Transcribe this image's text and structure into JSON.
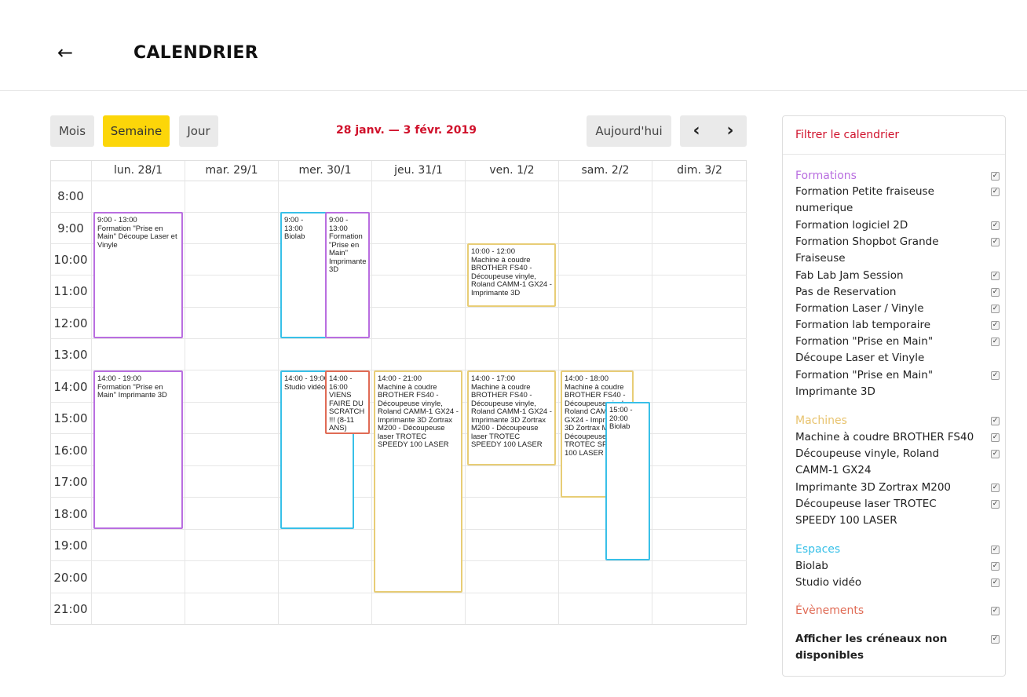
{
  "header": {
    "back_icon": "←",
    "title": "CALENDRIER"
  },
  "toolbar": {
    "views": [
      "Mois",
      "Semaine",
      "Jour"
    ],
    "active_view": "Semaine",
    "date_range": "28 janv. — 3 févr. 2019",
    "today_label": "Aujourd'hui",
    "prev_icon": "‹",
    "next_icon": "›"
  },
  "calendar": {
    "days": [
      "lun. 28/1",
      "mar. 29/1",
      "mer. 30/1",
      "jeu. 31/1",
      "ven. 1/2",
      "sam. 2/2",
      "dim. 3/2"
    ],
    "hours": [
      "8:00",
      "9:00",
      "10:00",
      "11:00",
      "12:00",
      "13:00",
      "14:00",
      "15:00",
      "16:00",
      "17:00",
      "18:00",
      "19:00",
      "20:00",
      "21:00"
    ],
    "events": [
      {
        "time": "9:00 - 13:00",
        "title": "Formation \"Prise en Main\" Découpe Laser et Vinyle"
      },
      {
        "time": "14:00 - 19:00",
        "title": "Formation \"Prise en Main\" Imprimante 3D"
      },
      {
        "time": "9:00 - 13:00",
        "title": "Biolab"
      },
      {
        "time": "9:00 - 13:00",
        "title": "Formation \"Prise en Main\" Imprimante 3D"
      },
      {
        "time": "14:00 - 19:00",
        "title": "Studio vidéo"
      },
      {
        "time": "14:00 - 16:00",
        "title": "VIENS FAIRE DU SCRATCH !!! (8-11 ANS)"
      },
      {
        "time": "14:00 - 21:00",
        "title": "Machine à coudre BROTHER FS40 - Découpeuse vinyle, Roland CAMM-1 GX24 - Imprimante 3D Zortrax M200 - Découpeuse laser TROTEC SPEEDY 100 LASER"
      },
      {
        "time": "10:00 - 12:00",
        "title": "Machine à coudre BROTHER FS40 - Découpeuse vinyle, Roland CAMM-1 GX24 - Imprimante 3D"
      },
      {
        "time": "14:00 - 17:00",
        "title": "Machine à coudre BROTHER FS40 - Découpeuse vinyle, Roland CAMM-1 GX24 - Imprimante 3D Zortrax M200 - Découpeuse laser TROTEC SPEEDY 100 LASER"
      },
      {
        "time": "14:00 - 18:00",
        "title": "Machine à coudre BROTHER FS40 - Découpeuse vinyle, Roland CAMM-1 GX24 - Imprimante 3D Zortrax M200 - Découpeuse laser TROTEC SPEEDY 100 LASER"
      },
      {
        "time": "15:00 - 20:00",
        "title": "Biolab"
      }
    ]
  },
  "filter": {
    "title": "Filtrer le calendrier",
    "formations_label": "Formations",
    "formations": [
      "Formation Petite fraiseuse numerique",
      "Formation logiciel 2D",
      "Formation Shopbot Grande Fraiseuse",
      "Fab Lab Jam Session",
      "Pas de Reservation",
      "Formation Laser / Vinyle",
      "Formation lab temporaire",
      "Formation \"Prise en Main\" Découpe Laser et Vinyle",
      "Formation \"Prise en Main\" Imprimante 3D"
    ],
    "machines_label": "Machines",
    "machines": [
      "Machine à coudre BROTHER FS40",
      "Découpeuse vinyle, Roland CAMM-1 GX24",
      "Imprimante 3D Zortrax M200",
      "Découpeuse laser TROTEC SPEEDY 100 LASER"
    ],
    "espaces_label": "Espaces",
    "espaces": [
      "Biolab",
      "Studio vidéo"
    ],
    "evenements_label": "Évènements",
    "show_unavailable": "Afficher les créneaux non disponibles",
    "check_icon": "✓"
  },
  "colors": {
    "accent_red": "#d0112b",
    "active_yellow": "#fcd609",
    "formations": "#b96ee0",
    "machines": "#e8c36e",
    "espaces": "#38c0e8",
    "evenements": "#e06b55"
  }
}
